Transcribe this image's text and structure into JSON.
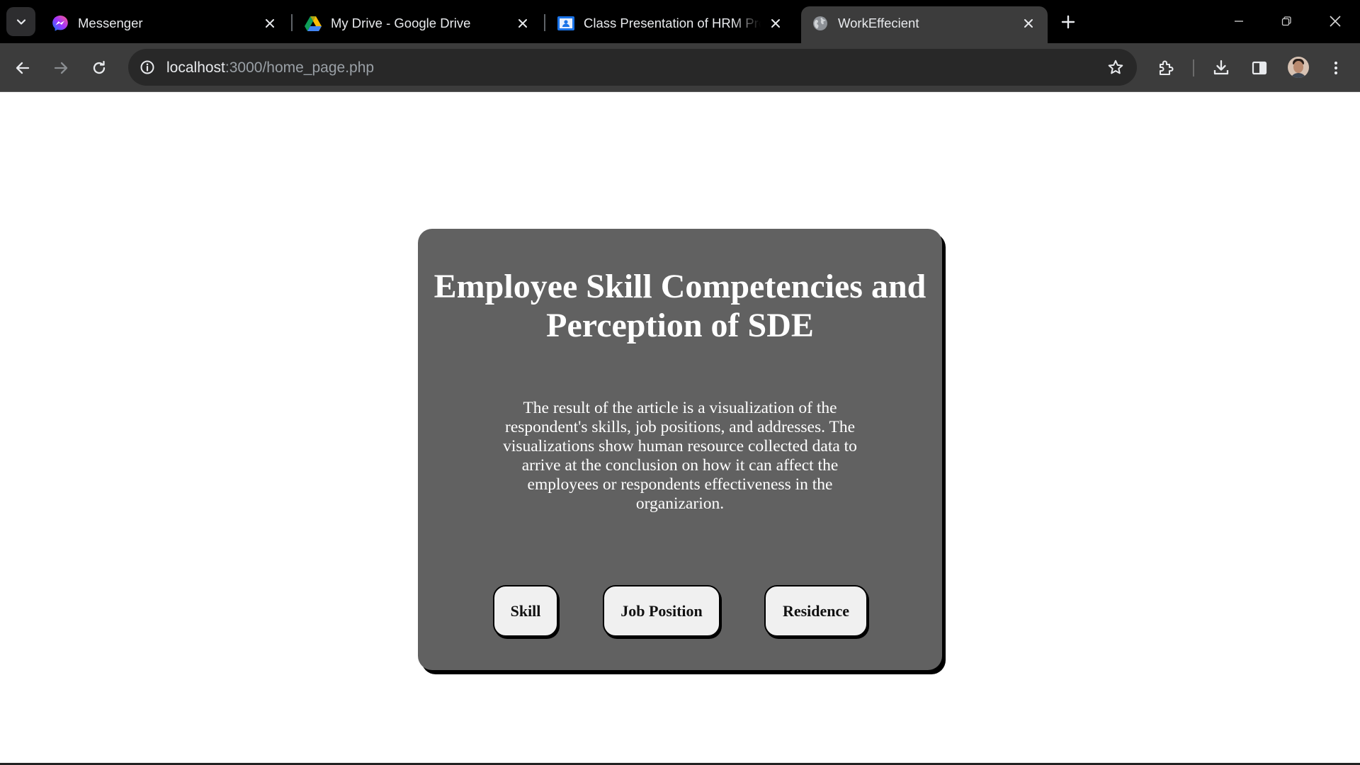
{
  "browser": {
    "tabs": [
      {
        "title": "Messenger",
        "icon": "messenger-icon",
        "active": false
      },
      {
        "title": "My Drive - Google Drive",
        "icon": "google-drive-icon",
        "active": false
      },
      {
        "title": "Class Presentation of HRM Project",
        "icon": "google-classroom-icon",
        "active": false
      },
      {
        "title": "WorkEffecient",
        "icon": "globe-icon",
        "active": true
      }
    ],
    "address": {
      "host": "localhost",
      "path": ":3000/home_page.php"
    }
  },
  "page": {
    "title": "Employee Skill Competencies and Perception of SDE",
    "description": "The result of the article is a visualization of the respondent's skills, job positions, and addresses. The visualizations show human resource collected data to arrive at the conclusion on how it can affect the employees or respondents effectiveness in the organizarion.",
    "buttons": {
      "skill": "Skill",
      "job_position": "Job Position",
      "residence": "Residence"
    }
  },
  "colors": {
    "card_background": "#616161",
    "button_background": "#f0f0f0",
    "tabstrip": "#000000",
    "toolbar": "#3c3c3c"
  }
}
